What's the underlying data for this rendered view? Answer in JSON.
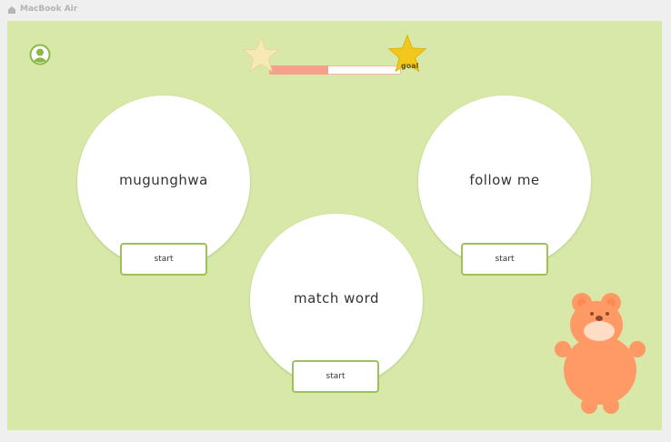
{
  "window": {
    "title": "MacBook Air",
    "icon": "home-icon"
  },
  "header": {
    "profile_icon": "user-icon",
    "progress": {
      "fraction": 0.45,
      "goal_label": "goal",
      "start_icon": "star-icon",
      "goal_icon": "star-icon"
    }
  },
  "games": [
    {
      "title": "mugunghwa",
      "button_label": "start"
    },
    {
      "title": "follow me",
      "button_label": "start"
    },
    {
      "title": "match word",
      "button_label": "start"
    }
  ],
  "mascot": {
    "icon": "bear-mascot"
  },
  "colors": {
    "background": "#d7e8a8",
    "accent": "#9dc25a",
    "progress_fill": "#f4a08a",
    "star_pale": "#f6e9b6",
    "star_gold": "#f2c81c",
    "bear": "#ff9966"
  }
}
